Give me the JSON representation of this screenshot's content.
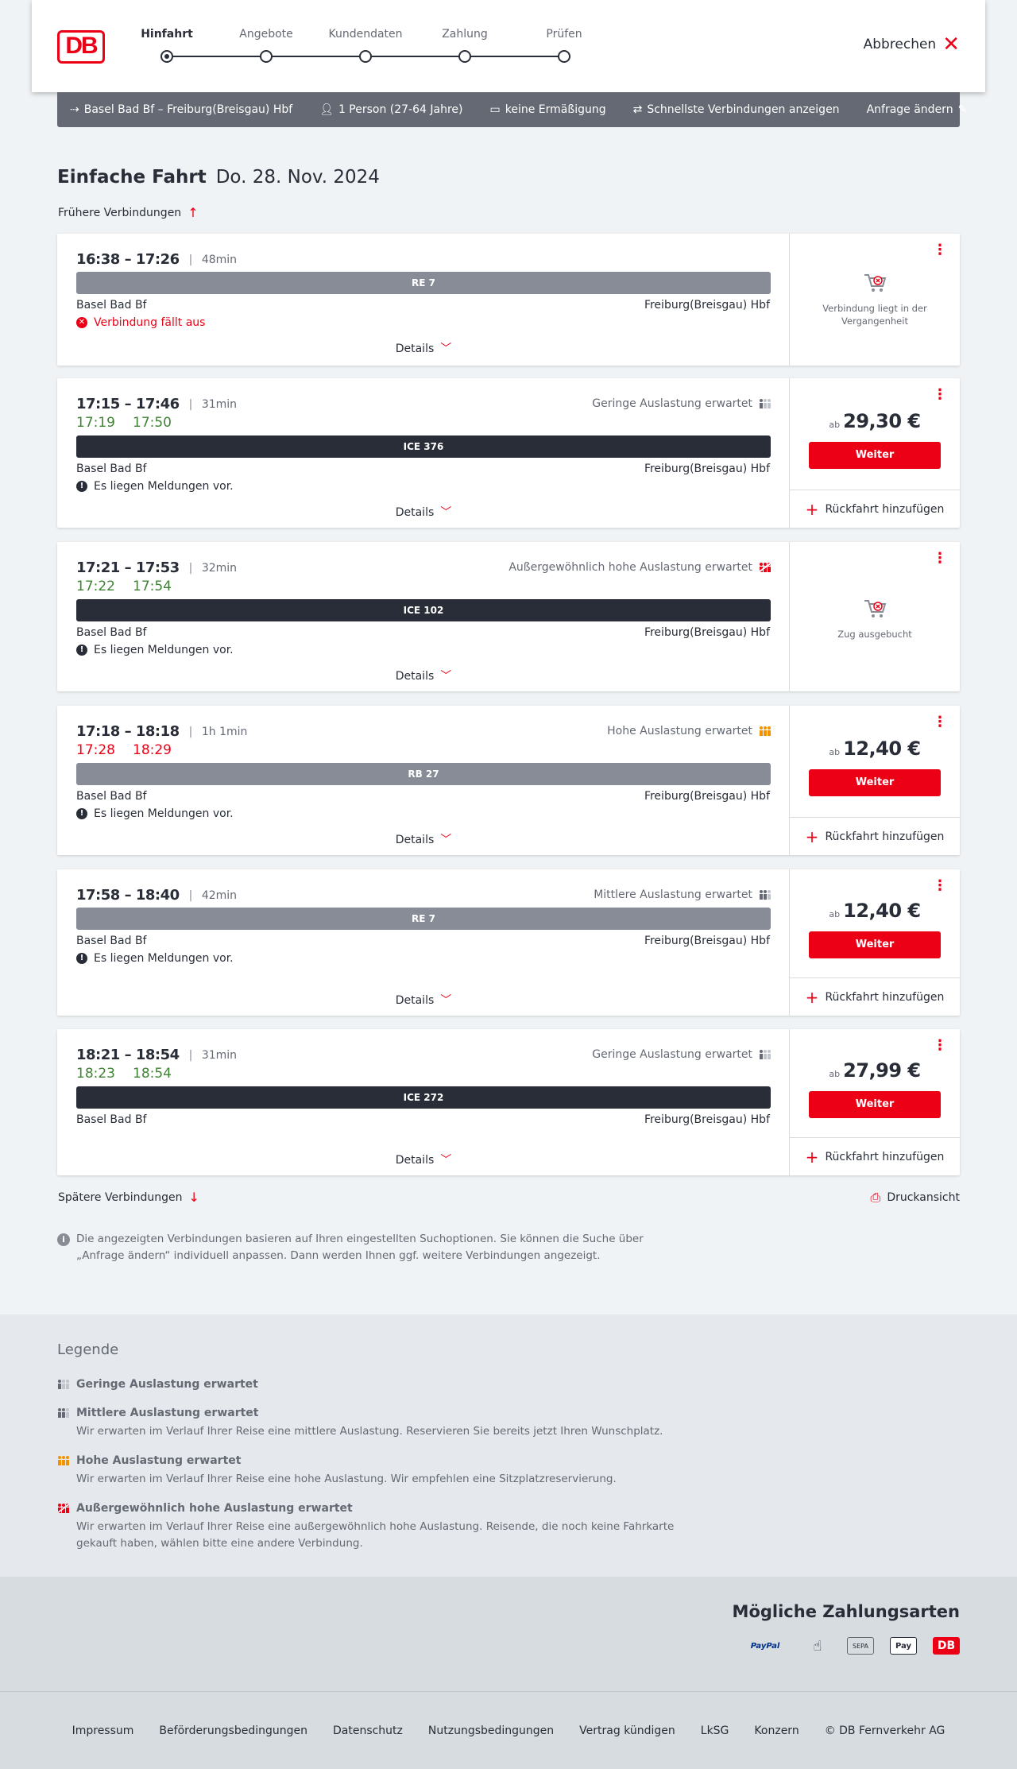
{
  "header": {
    "logo": "DB",
    "steps": [
      "Hinfahrt",
      "Angebote",
      "Kundendaten",
      "Zahlung",
      "Prüfen"
    ],
    "active_step": 0,
    "cancel_label": "Abbrechen"
  },
  "searchbar": {
    "route": "Basel Bad Bf – Freiburg(Breisgau) Hbf",
    "passengers": "1 Person (27-64 Jahre)",
    "discount": "keine Ermäßigung",
    "fastest": "Schnellste Verbindungen anzeigen",
    "edit": "Anfrage ändern"
  },
  "page": {
    "title": "Einfache Fahrt",
    "date": "Do. 28. Nov. 2024",
    "earlier": "Frühere Verbindungen",
    "later": "Spätere Verbindungen",
    "print": "Druckansicht",
    "info": "Die angezeigten Verbindungen basieren auf Ihren eingestellten Suchoptionen. Sie können die Suche über „Anfrage ändern“ individuell anpassen. Dann werden Ihnen ggf. weitere Verbindungen angezeigt.",
    "details_label": "Details",
    "weiter_label": "Weiter",
    "ab_label": "ab",
    "return_label": "Rückfahrt hinzufügen"
  },
  "connections": [
    {
      "times": "16:38 – 17:26",
      "duration": "48min",
      "train": "RE 7",
      "from": "Basel Bad Bf",
      "to": "Freiburg(Breisgau) Hbf",
      "message": "Verbindung fällt aus",
      "status": "past",
      "status_text": "Verbindung liegt in der Vergangenheit"
    },
    {
      "times": "17:15 – 17:46",
      "duration": "31min",
      "rt_dep": "17:19",
      "rt_arr": "17:50",
      "load": "Geringe Auslastung erwartet",
      "train": "ICE 376",
      "from": "Basel Bad Bf",
      "to": "Freiburg(Breisgau) Hbf",
      "message": "Es liegen Meldungen vor.",
      "price": "29,30 €"
    },
    {
      "times": "17:21 – 17:53",
      "duration": "32min",
      "rt_dep": "17:22",
      "rt_arr": "17:54",
      "load": "Außergewöhnlich hohe Auslastung erwartet",
      "train": "ICE 102",
      "from": "Basel Bad Bf",
      "to": "Freiburg(Breisgau) Hbf",
      "message": "Es liegen Meldungen vor.",
      "status": "full",
      "status_text": "Zug ausgebucht"
    },
    {
      "times": "17:18 – 18:18",
      "duration": "1h 1min",
      "rt_dep": "17:28",
      "rt_arr": "18:29",
      "load": "Hohe Auslastung erwartet",
      "train": "RB 27",
      "from": "Basel Bad Bf",
      "to": "Freiburg(Breisgau) Hbf",
      "message": "Es liegen Meldungen vor.",
      "price": "12,40 €"
    },
    {
      "times": "17:58 – 18:40",
      "duration": "42min",
      "load": "Mittlere Auslastung erwartet",
      "train": "RE 7",
      "from": "Basel Bad Bf",
      "to": "Freiburg(Breisgau) Hbf",
      "message": "Es liegen Meldungen vor.",
      "price": "12,40 €"
    },
    {
      "times": "18:21 – 18:54",
      "duration": "31min",
      "rt_dep": "18:23",
      "rt_arr": "18:54",
      "load": "Geringe Auslastung erwartet",
      "train": "ICE 272",
      "from": "Basel Bad Bf",
      "to": "Freiburg(Breisgau) Hbf",
      "price": "27,99 €"
    }
  ],
  "legend": {
    "title": "Legende",
    "items": [
      {
        "title": "Geringe Auslastung erwartet",
        "desc": ""
      },
      {
        "title": "Mittlere Auslastung erwartet",
        "desc": "Wir erwarten im Verlauf Ihrer Reise eine mittlere Auslastung. Reservieren Sie bereits jetzt Ihren Wunschplatz."
      },
      {
        "title": "Hohe Auslastung erwartet",
        "desc": "Wir erwarten im Verlauf Ihrer Reise eine hohe Auslastung. Wir empfehlen eine Sitzplatzreservierung."
      },
      {
        "title": "Außergewöhnlich hohe Auslastung erwartet",
        "desc": "Wir erwarten im Verlauf Ihrer Reise eine außergewöhnlich hohe Auslastung. Reisende, die noch keine Fahrkarte gekauft haben, wählen bitte eine andere Verbindung."
      }
    ]
  },
  "payments": {
    "title": "Mögliche Zahlungsarten",
    "methods": [
      "PayPal",
      "contactless",
      "SEPA",
      "Pay",
      "DB"
    ]
  },
  "footer": {
    "links": [
      "Impressum",
      "Beförderungsbedingungen",
      "Datenschutz",
      "Nutzungsbedingungen",
      "Vertrag kündigen",
      "LkSG",
      "Konzern",
      "© DB Fernverkehr AG"
    ]
  },
  "colors": {
    "accent": "#ec0016",
    "on_time": "#408335",
    "dark": "#282d37"
  }
}
